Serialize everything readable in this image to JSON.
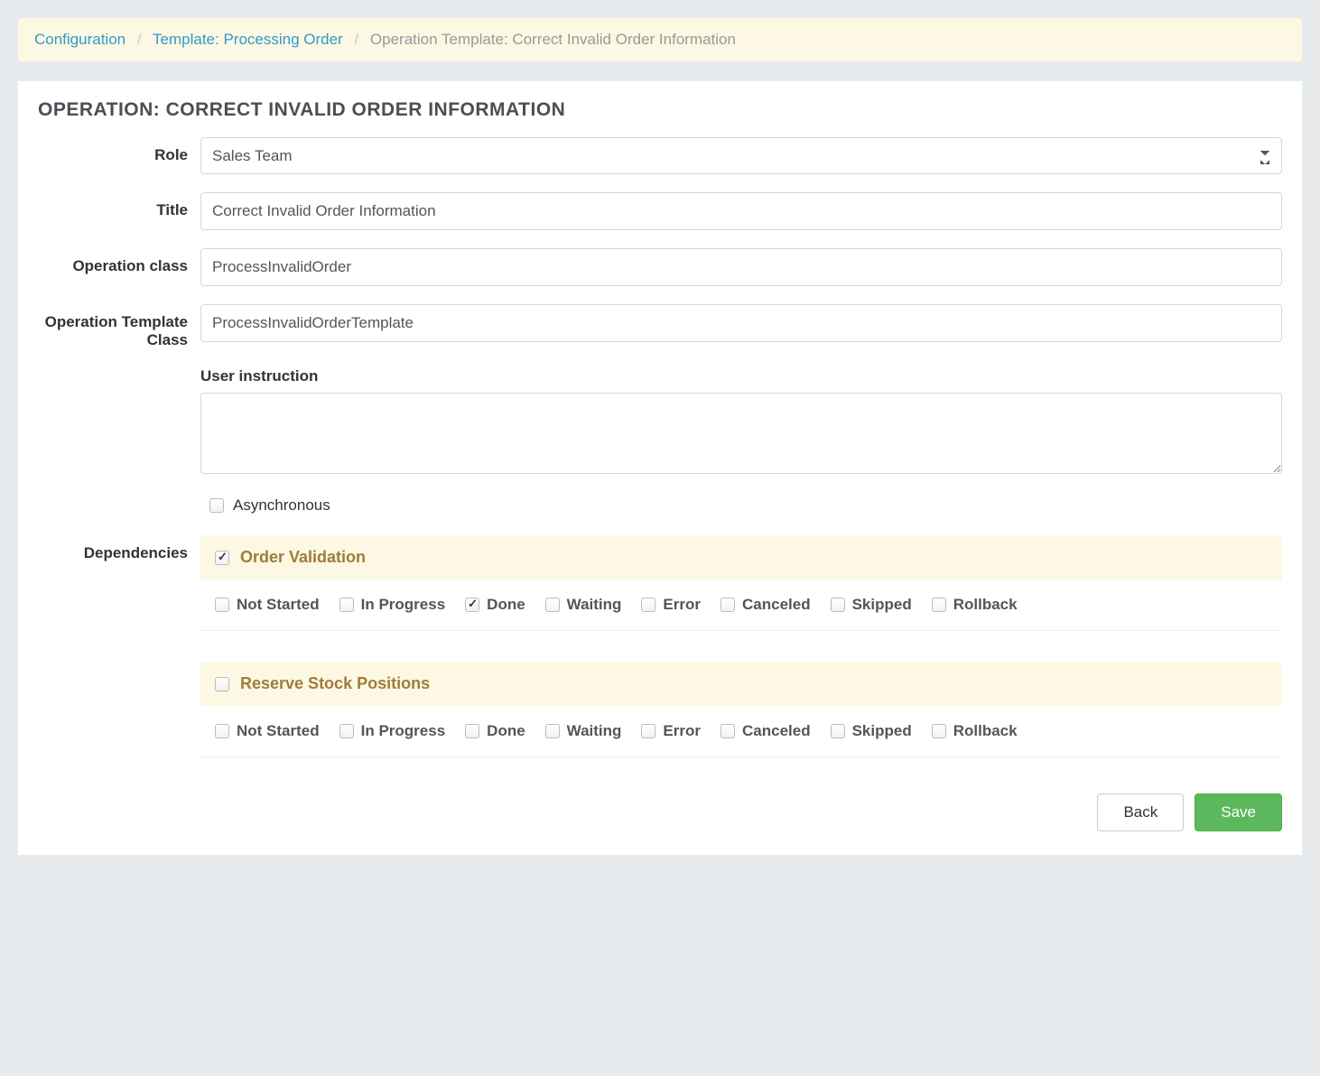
{
  "breadcrumb": {
    "configuration": "Configuration",
    "template": "Template: Processing Order",
    "current": "Operation Template: Correct Invalid Order Information"
  },
  "panel": {
    "title": "OPERATION: CORRECT INVALID ORDER INFORMATION"
  },
  "labels": {
    "role": "Role",
    "title": "Title",
    "operationClass": "Operation class",
    "operationTemplateClass": "Operation Template Class",
    "userInstruction": "User instruction",
    "asynchronous": "Asynchronous",
    "dependencies": "Dependencies"
  },
  "values": {
    "role": "Sales Team",
    "title": "Correct Invalid Order Information",
    "operationClass": "ProcessInvalidOrder",
    "operationTemplateClass": "ProcessInvalidOrderTemplate",
    "userInstruction": "",
    "asynchronous": false
  },
  "dependencies": [
    {
      "title": "Order Validation",
      "enabled": true,
      "states": {
        "Not Started": false,
        "In Progress": false,
        "Done": true,
        "Waiting": false,
        "Error": false,
        "Canceled": false,
        "Skipped": false,
        "Rollback": false
      }
    },
    {
      "title": "Reserve Stock Positions",
      "enabled": false,
      "states": {
        "Not Started": false,
        "In Progress": false,
        "Done": false,
        "Waiting": false,
        "Error": false,
        "Canceled": false,
        "Skipped": false,
        "Rollback": false
      }
    }
  ],
  "buttons": {
    "back": "Back",
    "save": "Save"
  }
}
